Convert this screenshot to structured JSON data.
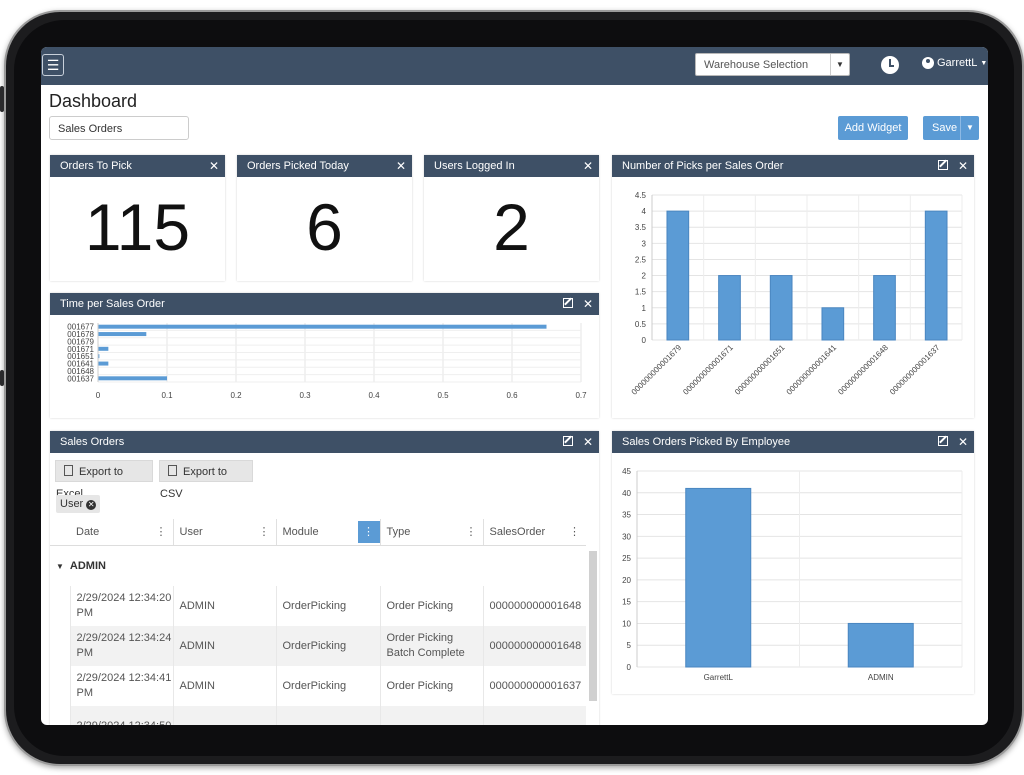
{
  "topbar": {
    "menu_icon": "hamburger-icon",
    "warehouse_selection": "Warehouse Selection",
    "history_icon": "clock-icon",
    "user_name": "GarrettL"
  },
  "page": {
    "title": "Dashboard",
    "dashboard_select": "Sales Orders",
    "add_widget_label": "Add Widget",
    "save_label": "Save"
  },
  "stats": [
    {
      "title": "Orders To Pick",
      "value": "115"
    },
    {
      "title": "Orders Picked Today",
      "value": "6"
    },
    {
      "title": "Users Logged In",
      "value": "2"
    }
  ],
  "time_chart": {
    "title": "Time per Sales Order",
    "chart_data": {
      "type": "bar",
      "orientation": "horizontal",
      "categories": [
        "001677",
        "001678",
        "001679",
        "001671",
        "001651",
        "001641",
        "001648",
        "001637"
      ],
      "values": [
        0.65,
        0.07,
        0,
        0.015,
        0.002,
        0.015,
        0,
        0.1
      ],
      "xlim": [
        0,
        0.7
      ],
      "xticks": [
        "0",
        "0.1",
        "0.2",
        "0.3",
        "0.4",
        "0.5",
        "0.6",
        "0.7"
      ],
      "grid": true
    }
  },
  "picks_chart": {
    "title": "Number of Picks per Sales Order",
    "chart_data": {
      "type": "bar",
      "categories": [
        "000000000001679",
        "000000000001671",
        "000000000001651",
        "000000000001641",
        "000000000001648",
        "000000000001637"
      ],
      "values": [
        4,
        2,
        2,
        1,
        2,
        4
      ],
      "ylim": [
        0,
        4.5
      ],
      "yticks": [
        "0",
        "0.5",
        "1",
        "1.5",
        "2",
        "2.5",
        "3",
        "3.5",
        "4",
        "4.5"
      ],
      "grid": true
    }
  },
  "employee_chart": {
    "title": "Sales Orders Picked By Employee",
    "chart_data": {
      "type": "bar",
      "categories": [
        "GarrettL",
        "ADMIN"
      ],
      "values": [
        41,
        10
      ],
      "ylim": [
        0,
        45
      ],
      "yticks": [
        "0",
        "5",
        "10",
        "15",
        "20",
        "25",
        "30",
        "35",
        "40",
        "45"
      ],
      "grid": true
    }
  },
  "sales_orders": {
    "title": "Sales Orders",
    "export_excel": "Export to Excel",
    "export_csv": "Export to CSV",
    "group_chip": "User",
    "columns": [
      "Date",
      "User",
      "Module",
      "Type",
      "SalesOrder"
    ],
    "group_label": "ADMIN",
    "rows": [
      {
        "date": "2/29/2024 12:34:20 PM",
        "user": "ADMIN",
        "module": "OrderPicking",
        "type": "Order Picking",
        "order": "000000000001648"
      },
      {
        "date": "2/29/2024 12:34:24 PM",
        "user": "ADMIN",
        "module": "OrderPicking",
        "type": "Order Picking Batch Complete",
        "order": "000000000001648"
      },
      {
        "date": "2/29/2024 12:34:41 PM",
        "user": "ADMIN",
        "module": "OrderPicking",
        "type": "Order Picking",
        "order": "000000000001637"
      },
      {
        "date": "2/29/2024 12:34:50",
        "user": "",
        "module": "",
        "type": "",
        "order": ""
      }
    ]
  },
  "colors": {
    "header": "#3e5066",
    "accent": "#5b9bd5",
    "bar": "#5b9bd5"
  }
}
